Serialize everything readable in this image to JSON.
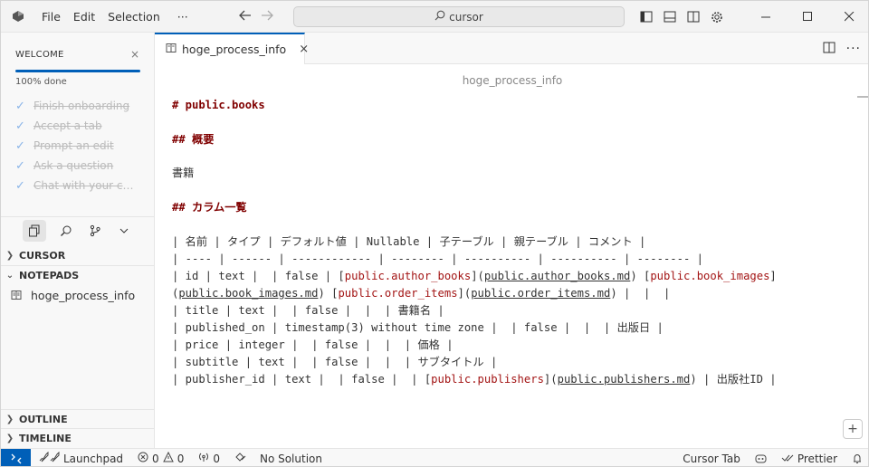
{
  "menu": {
    "file": "File",
    "edit": "Edit",
    "selection": "Selection",
    "more": "···"
  },
  "command_center": {
    "text": "cursor"
  },
  "sidebar": {
    "welcome": {
      "title": "WELCOME",
      "close": "×",
      "progress_text": "100% done",
      "progress": 1.0
    },
    "tasks": [
      "Finish onboarding",
      "Accept a tab",
      "Prompt an edit",
      "Ask a question",
      "Chat with your co..."
    ],
    "sections": {
      "cursor": "CURSOR",
      "notepads": "NOTEPADS",
      "outline": "OUTLINE",
      "timeline": "TIMELINE"
    },
    "notepad_item": "hoge_process_info"
  },
  "tab": {
    "label": "hoge_process_info",
    "close": "×"
  },
  "editor": {
    "doc_name": "hoge_process_info",
    "lines": {
      "l1": "# public.books",
      "l2": "## 概要",
      "l3": "書籍",
      "l4": "## カラム一覧",
      "l5": "| 名前 | タイプ | デフォルト値 | Nullable | 子テーブル | 親テーブル | コメント |",
      "l6": "| ---- | ------ | ------------ | -------- | ---------- | ---------- | -------- |",
      "l7a": "| id | text |  | false | [",
      "l7b": "public.author_books",
      "l7c": "](",
      "l7d": "public.author_books.md",
      "l7e": ") [",
      "l7f": "public.book_images",
      "l7g": "]",
      "l8a": "(",
      "l8b": "public.book_images.md",
      "l8c": ") [",
      "l8d": "public.order_items",
      "l8e": "](",
      "l8f": "public.order_items.md",
      "l8g": ") |  |  |",
      "l9": "| title | text |  | false |  |  | 書籍名 |",
      "l10": "| published_on | timestamp(3) without time zone |  | false |  |  | 出版日 |",
      "l11": "| price | integer |  | false |  |  | 価格 |",
      "l12": "| subtitle | text |  | false |  |  | サブタイトル |",
      "l13a": "| publisher_id | text |  | false |  | [",
      "l13b": "public.publishers",
      "l13c": "](",
      "l13d": "public.publishers.md",
      "l13e": ") | 出版社ID |"
    }
  },
  "statusbar": {
    "launchpad": "Launchpad",
    "errors": "0",
    "warnings": "0",
    "ports": "0",
    "solution": "No Solution",
    "cursor_tab": "Cursor Tab",
    "prettier": "Prettier"
  },
  "colors": {
    "accent": "#005fb8",
    "heading": "#800000",
    "link": "#a31515"
  }
}
